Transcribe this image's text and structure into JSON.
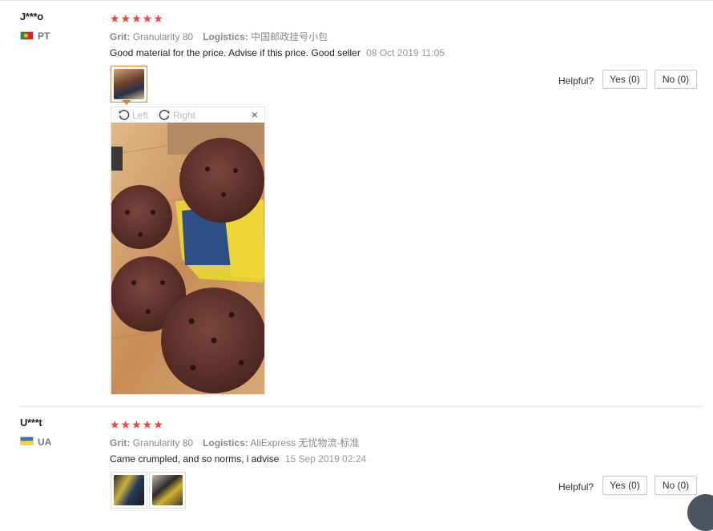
{
  "reviews": [
    {
      "user": "J***o",
      "country": "PT",
      "stars": "★★★★★",
      "grit_label": "Grit:",
      "grit_value": "Granularity 80",
      "logistics_label": "Logistics:",
      "logistics_value": "中国邮政挂号小包",
      "text": "Good material for the price. Advise if this price. Good seller",
      "date": "08 Oct 2019 11:05",
      "helpful_label": "Helpful?",
      "yes_label": "Yes (0)",
      "no_label": "No (0)",
      "viewer": {
        "rotate_left_label": "Left",
        "rotate_right_label": "Right",
        "close_glyph": "×"
      }
    },
    {
      "user": "U***t",
      "country": "UA",
      "stars": "★★★★★",
      "grit_label": "Grit:",
      "grit_value": "Granularity 80",
      "logistics_label": "Logistics:",
      "logistics_value": "AliExpress 无忧物流-标准",
      "text": "Came crumpled, and so norms, i advise",
      "date": "15 Sep 2019 02:24",
      "helpful_label": "Helpful?",
      "yes_label": "Yes (0)",
      "no_label": "No (0)"
    }
  ],
  "icons": {
    "flag_pt": "portugal-flag-icon",
    "flag_ua": "ukraine-flag-icon",
    "rotate_left": "rotate-left-icon",
    "rotate_right": "rotate-right-icon",
    "close": "close-icon"
  },
  "colors": {
    "star": "#f5413d",
    "active_thumb": "#e5832a"
  }
}
